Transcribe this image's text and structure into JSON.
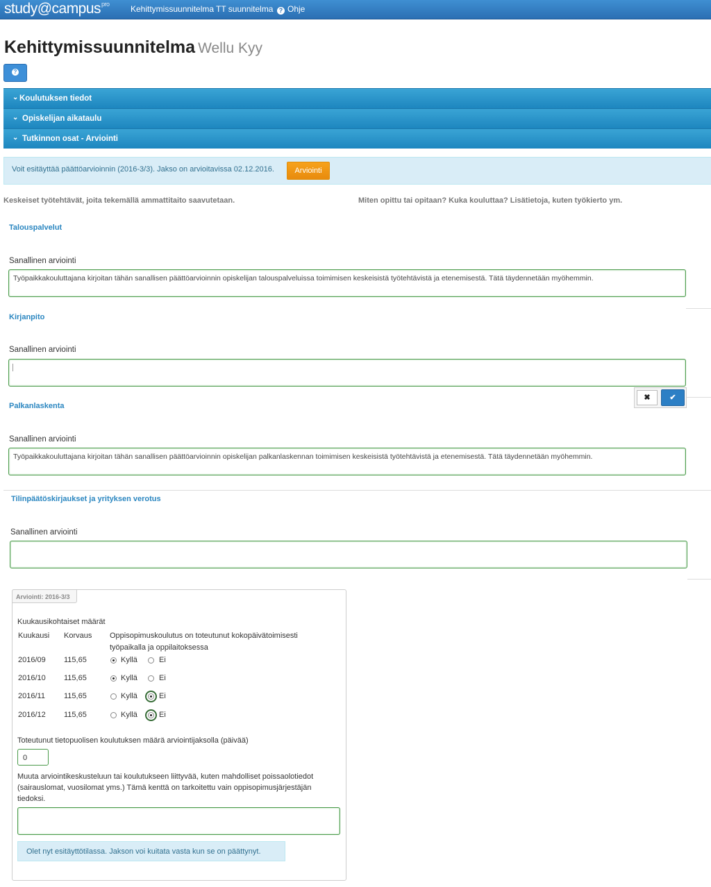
{
  "nav": {
    "brand": "study@campus",
    "brand_sup": "pro",
    "links": [
      "Kehittymissuunnitelma",
      "TT suunnitelma",
      "Ohje"
    ]
  },
  "header": {
    "title": "Kehittymissuunnitelma",
    "subtitle": "Wellu Kyy"
  },
  "accordion": [
    "Koulutuksen tiedot",
    "Opiskelijan aikataulu",
    "Tutkinnon osat - Arviointi"
  ],
  "alert": {
    "text": "Voit esitäyttää päättöarvioinnin (2016-3/3). Jakso on arvioitavissa 02.12.2016.",
    "button": "Arviointi"
  },
  "columns": {
    "left": "Keskeiset työtehtävät, joita tekemällä ammattitaito saavutetaan.",
    "right": "Miten opittu tai opitaan? Kuka kouluttaa? Lisätietoja, kuten työkierto ym."
  },
  "sections": [
    {
      "title": "Talouspalvelut",
      "label": "Sanallinen arviointi",
      "value": "Työpaikkakouluttajana kirjoitan tähän sanallisen päättöarvioinnin opiskelijan talouspalveluissa toimimisen keskeisistä työtehtävistä ja etenemisestä. Tätä täydennetään myöhemmin."
    },
    {
      "title": "Kirjanpito",
      "label": "Sanallinen arviointi",
      "value": ""
    },
    {
      "title": "Palkanlaskenta",
      "label": "Sanallinen arviointi",
      "value": "Työpaikkakouluttajana kirjoitan tähän sanallisen päättöarvioinnin opiskelijan palkanlaskennan toimimisen keskeisistä työtehtävistä ja etenemisestä. Tätä täydennetään myöhemmin."
    },
    {
      "title": "Tilinpäätöskirjaukset ja yrityksen verotus",
      "label": "Sanallinen arviointi",
      "value": ""
    }
  ],
  "edit_buttons": {
    "cancel": "✖",
    "confirm": "✔"
  },
  "panel": {
    "tag": "Arviointi: 2016-3/3",
    "heading": "Kuukausikohtaiset määrät",
    "col_month": "Kuukausi",
    "col_pay": "Korvaus",
    "col_desc_line1": "Oppisopimuskoulutus on toteutunut kokopäivätoimisesti",
    "col_desc_line2": "työpaikalla ja oppilaitoksessa",
    "yes": "Kyllä",
    "no": "Ei",
    "rows": [
      {
        "month": "2016/09",
        "pay": "115,65",
        "selected": "yes"
      },
      {
        "month": "2016/10",
        "pay": "115,65",
        "selected": "yes"
      },
      {
        "month": "2016/11",
        "pay": "115,65",
        "selected": "no"
      },
      {
        "month": "2016/12",
        "pay": "115,65",
        "selected": "no"
      }
    ],
    "days_label": "Toteutunut tietopuolisen koulutuksen määrä arviointijaksolla (päivää)",
    "days_value": "0",
    "other_line1": "Muuta arviointikeskusteluun tai koulutukseen liittyvää, kuten mahdolliset poissaolotiedot",
    "other_line2": "(sairauslomat, vuosilomat yms.) Tämä kenttä on tarkoitettu vain oppisopimusjärjestäjän",
    "other_line3": "tiedoksi.",
    "other_value": "",
    "notice": "Olet nyt esitäyttötilassa. Jakson voi kuitata vasta kun se on päättynyt."
  }
}
